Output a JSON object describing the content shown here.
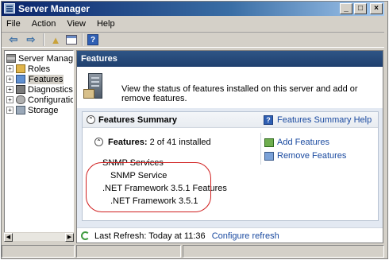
{
  "window": {
    "title": "Server Manager"
  },
  "menu": [
    "File",
    "Action",
    "View",
    "Help"
  ],
  "toolbar": {
    "icons": [
      "back-arrow",
      "forward-arrow",
      "up-folder",
      "show-hide-console-tree",
      "help"
    ]
  },
  "tree": {
    "items": [
      {
        "label": "Server Manager (",
        "icon": "server",
        "expandable": false
      },
      {
        "label": "Roles",
        "icon": "roles",
        "expandable": true
      },
      {
        "label": "Features",
        "icon": "features",
        "expandable": true,
        "selected": true
      },
      {
        "label": "Diagnostics",
        "icon": "diagnostics",
        "expandable": true
      },
      {
        "label": "Configuration",
        "icon": "configuration",
        "expandable": true
      },
      {
        "label": "Storage",
        "icon": "storage",
        "expandable": true
      }
    ]
  },
  "main": {
    "header": "Features",
    "intro": "View the status of features installed on this server and add or remove features.",
    "summary": {
      "title": "Features Summary",
      "help_link": "Features Summary Help",
      "features_label": "Features:",
      "features_count": "2 of 41 installed",
      "tasks": [
        "Add Features",
        "Remove Features"
      ],
      "installed": [
        {
          "label": "SNMP Services",
          "level": 0
        },
        {
          "label": "SNMP Service",
          "level": 1
        },
        {
          "label": ".NET Framework 3.5.1 Features",
          "level": 0
        },
        {
          "label": ".NET Framework 3.5.1",
          "level": 1
        }
      ]
    },
    "footer": {
      "last_refresh": "Last Refresh: Today at 11:36",
      "configure_refresh": "Configure refresh"
    }
  },
  "colors": {
    "header": "#1f3f6e",
    "link": "#1a4aa0",
    "highlight": "#d02020"
  }
}
